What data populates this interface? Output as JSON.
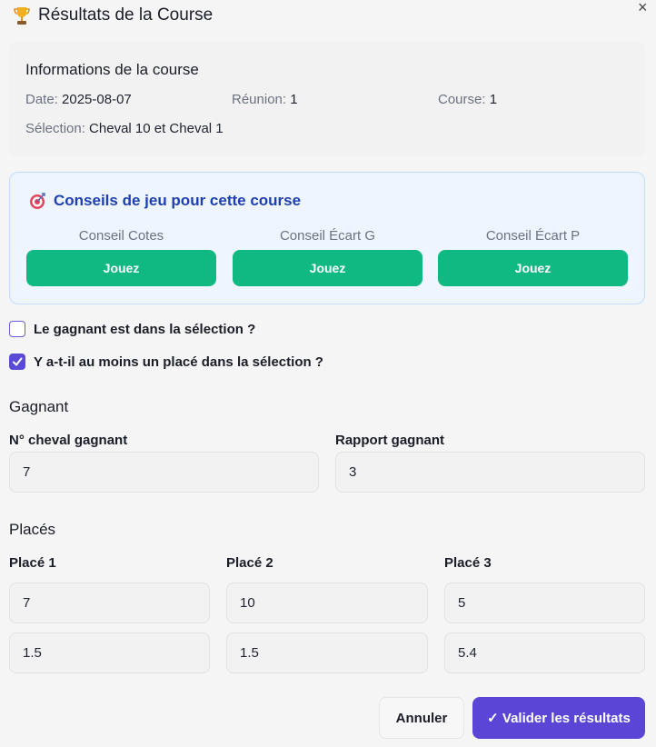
{
  "dialog": {
    "title": "Résultats de la Course",
    "title_icon": "trophy-icon",
    "close_label": "×"
  },
  "info": {
    "title": "Informations de la course",
    "date_label": "Date:",
    "date_value": "2025-08-07",
    "reunion_label": "Réunion:",
    "reunion_value": "1",
    "course_label": "Course:",
    "course_value": "1",
    "selection_label": "Sélection:",
    "selection_value": "Cheval 10 et Cheval 1"
  },
  "tips": {
    "title": "Conseils de jeu pour cette course",
    "icon": "target-icon",
    "items": [
      {
        "label": "Conseil Cotes",
        "button": "Jouez"
      },
      {
        "label": "Conseil Écart G",
        "button": "Jouez"
      },
      {
        "label": "Conseil Écart P",
        "button": "Jouez"
      }
    ],
    "accent_color": "#10b981"
  },
  "checks": [
    {
      "label": "Le gagnant est dans la sélection ?",
      "checked": false
    },
    {
      "label": "Y a-t-il au moins un placé dans la sélection ?",
      "checked": true
    }
  ],
  "winner": {
    "section_title": "Gagnant",
    "horse_label": "N° cheval gagnant",
    "horse_value": "7",
    "payout_label": "Rapport gagnant",
    "payout_value": "3"
  },
  "places": {
    "section_title": "Placés",
    "columns": [
      {
        "label": "Placé 1",
        "horse": "7",
        "payout": "1.5"
      },
      {
        "label": "Placé 2",
        "horse": "10",
        "payout": "1.5"
      },
      {
        "label": "Placé 3",
        "horse": "5",
        "payout": "5.4"
      }
    ]
  },
  "footer": {
    "cancel_label": "Annuler",
    "validate_label": "✓ Valider les résultats",
    "validate_color": "#5b45d6"
  }
}
